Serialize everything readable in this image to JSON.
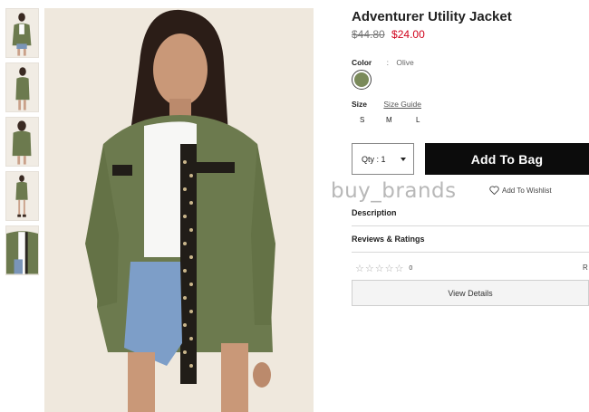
{
  "thumbnails": [
    {
      "name": "thumbnail-front"
    },
    {
      "name": "thumbnail-side"
    },
    {
      "name": "thumbnail-back"
    },
    {
      "name": "thumbnail-full"
    },
    {
      "name": "thumbnail-detail"
    }
  ],
  "product": {
    "title": "Adventurer Utility Jacket",
    "price_old": "$44.80",
    "price_new": "$24.00"
  },
  "color": {
    "label": "Color",
    "separator": ":",
    "value": "Olive",
    "swatch_hex": "#7a8a5a"
  },
  "size": {
    "label": "Size",
    "guide_link": "Size Guide",
    "options": [
      "S",
      "M",
      "L"
    ]
  },
  "quantity": {
    "label": "Qty : 1"
  },
  "actions": {
    "add_to_bag": "Add To Bag",
    "add_to_wishlist": "Add To Wishlist",
    "view_details": "View Details"
  },
  "watermark": "buy_brands",
  "sections": {
    "description": "Description",
    "reviews": "Reviews & Ratings"
  },
  "rating": {
    "stars": 5,
    "filled": 0,
    "count": "0",
    "trailing": "R"
  },
  "colors": {
    "accent_black": "#0c0c0c",
    "sale_red": "#d0021b",
    "olive": "#7a8a5a"
  }
}
